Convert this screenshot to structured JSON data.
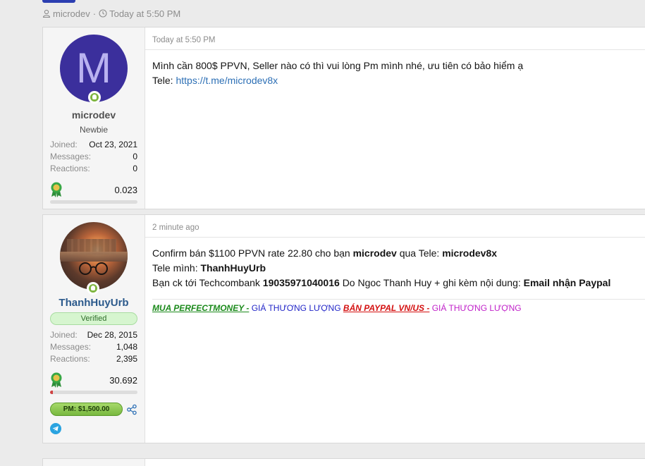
{
  "thread": {
    "author": "microdev",
    "separator": "·",
    "date": "Today at 5:50 PM"
  },
  "posts": [
    {
      "avatar_letter": "M",
      "username": "microdev",
      "user_title": "Newbie",
      "stats": [
        {
          "label": "Joined:",
          "value": "Oct 23, 2021"
        },
        {
          "label": "Messages:",
          "value": "0"
        },
        {
          "label": "Reactions:",
          "value": "0"
        }
      ],
      "trophy_points": "0.023",
      "trophy_progress": 0.0,
      "timestamp": "Today at 5:50 PM",
      "body": {
        "line1": "Mình cần 800$ PPVN, Seller nào có thì vui lòng Pm mình nhé, ưu tiên có bảo hiểm ạ",
        "line2_prefix": "Tele:",
        "link": "https://t.me/microdev8x"
      }
    },
    {
      "username": "ThanhHuyUrb",
      "badge": "Verified",
      "stats": [
        {
          "label": "Joined:",
          "value": "Dec 28, 2015"
        },
        {
          "label": "Messages:",
          "value": "1,048"
        },
        {
          "label": "Reactions:",
          "value": "2,395"
        }
      ],
      "trophy_points": "30.692",
      "trophy_progress": 0.03,
      "pm_badge": "PM: $1,500.00",
      "timestamp": "2 minute ago",
      "body": {
        "l1_a": "Confirm bán $1100 PPVN rate 22.80 cho bạn",
        "l1_b": "microdev",
        "l1_c": "qua Tele:",
        "l1_d": "microdev8x",
        "l2_a": "Tele mình:",
        "l2_b": "ThanhHuyUrb",
        "l3_a": "Bạn ck tới Techcombank",
        "l3_b": "19035971040016",
        "l3_c": "Do Ngoc Thanh Huy + ghi kèm nội dung:",
        "l3_d": "Email nhận Paypal"
      },
      "signature": {
        "a": "MUA PERFECTMONEY -",
        "b": "GIÁ THƯƠNG LƯỢNG",
        "c": "BÁN PAYPAL VN/US -",
        "d": "GIÁ THƯƠNG LƯỢNG"
      }
    }
  ],
  "colors": {
    "accent": "#2c3eb1",
    "link": "#2c6fb5",
    "online": "#7eb53f"
  },
  "icons": [
    "user-icon",
    "clock-icon",
    "online-icon",
    "trophy-icon",
    "share-icon",
    "telegram-icon"
  ]
}
